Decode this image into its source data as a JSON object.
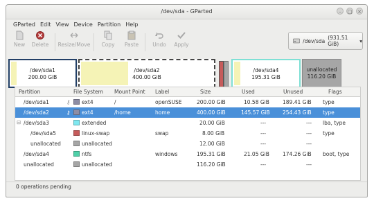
{
  "window": {
    "title": "/dev/sda - GParted"
  },
  "menu": [
    "GParted",
    "Edit",
    "View",
    "Device",
    "Partition",
    "Help"
  ],
  "toolbar": {
    "new": "New",
    "delete": "Delete",
    "resize_move": "Resize/Move",
    "copy": "Copy",
    "paste": "Paste",
    "undo": "Undo",
    "apply": "Apply"
  },
  "device": {
    "name": "/dev/sda",
    "size": "(931.51 GiB)"
  },
  "map": [
    {
      "name": "/dev/sda1",
      "size": "200.00 GiB",
      "border": "#223f66",
      "fill": "#f5f3b6"
    },
    {
      "name": "/dev/sda2",
      "size": "400.00 GiB",
      "border": "#555555",
      "fill": "#f5f3b6"
    },
    {
      "name": "/dev/sda4",
      "size": "195.31 GiB",
      "border": "#7fe0d5",
      "fill": "#f5f3b6"
    },
    {
      "name": "unallocated",
      "size": "116.20 GiB",
      "border": "#9a9a9a",
      "fill": "#a6a6a6"
    }
  ],
  "columns": {
    "partition": "Partition",
    "filesystem": "File System",
    "mount": "Mount Point",
    "label": "Label",
    "size": "Size",
    "used": "Used",
    "unused": "Unused",
    "flags": "Flags"
  },
  "rows": [
    {
      "partition": "/dev/sda1",
      "fs": "ext4",
      "fs_color": "#8d8da5",
      "mount": "/",
      "label": "openSUSE",
      "size": "200.00 GiB",
      "used": "10.58 GiB",
      "unused": "189.41 GiB",
      "flags": "type"
    },
    {
      "partition": "/dev/sda2",
      "fs": "ext4",
      "fs_color": "#8d8da5",
      "mount": "/home",
      "label": "home",
      "size": "400.00 GiB",
      "used": "145.57 GiB",
      "unused": "254.43 GiB",
      "flags": "type"
    },
    {
      "partition": "/dev/sda3",
      "fs": "extended",
      "fs_color": "#7fe8f0",
      "mount": "",
      "label": "",
      "size": "20.00 GiB",
      "used": "---",
      "unused": "---",
      "flags": "lba, type"
    },
    {
      "partition": "/dev/sda5",
      "fs": "linux-swap",
      "fs_color": "#c65b5b",
      "mount": "",
      "label": "swap",
      "size": "8.00 GiB",
      "used": "---",
      "unused": "---",
      "flags": "type"
    },
    {
      "partition": "unallocated",
      "fs": "unallocated",
      "fs_color": "#a6a6a6",
      "mount": "",
      "label": "",
      "size": "12.00 GiB",
      "used": "---",
      "unused": "---",
      "flags": ""
    },
    {
      "partition": "/dev/sda4",
      "fs": "ntfs",
      "fs_color": "#4fd0a8",
      "mount": "",
      "label": "windows",
      "size": "195.31 GiB",
      "used": "21.05 GiB",
      "unused": "174.26 GiB",
      "flags": "boot, type"
    },
    {
      "partition": "unallocated",
      "fs": "unallocated",
      "fs_color": "#a6a6a6",
      "mount": "",
      "label": "",
      "size": "116.20 GiB",
      "used": "---",
      "unused": "---",
      "flags": ""
    }
  ],
  "status": "0 operations pending"
}
